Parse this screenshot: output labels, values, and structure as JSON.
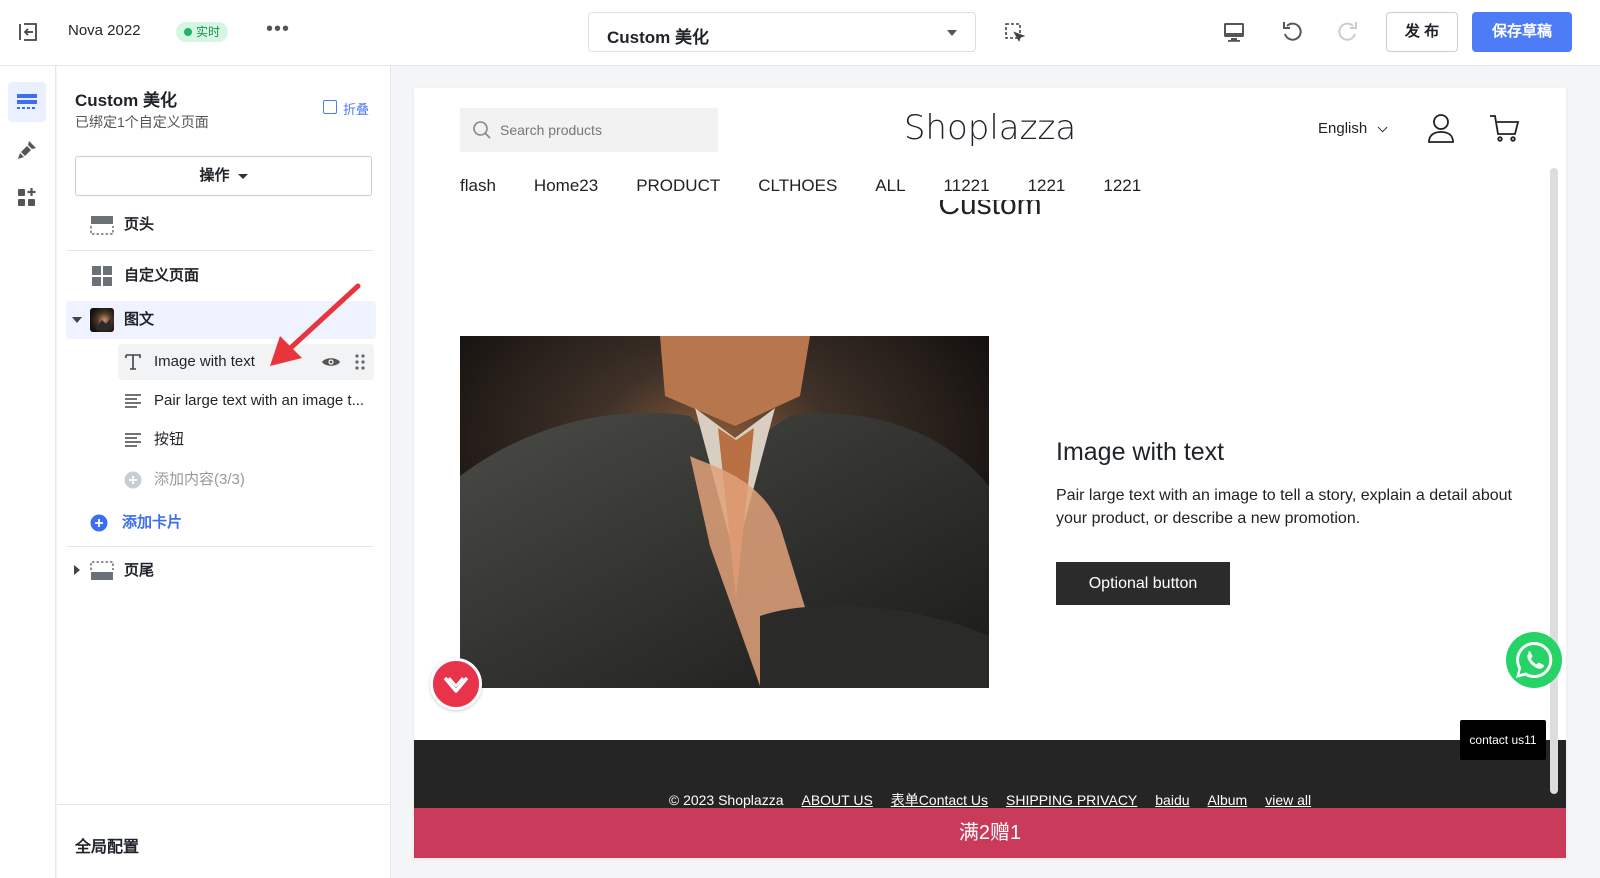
{
  "topbar": {
    "store_name": "Nova 2022",
    "live_badge": "实时",
    "more": "•••",
    "page_select": "Custom 美化",
    "publish": "发 布",
    "save_draft": "保存草稿"
  },
  "panel": {
    "title": "Custom 美化",
    "subtitle": "已绑定1个自定义页面",
    "collapse": "折叠",
    "operations": "操作",
    "header_section": "页头",
    "custom_page": "自定义页面",
    "image_text_section": "图文",
    "blocks": [
      {
        "label": "Image with text"
      },
      {
        "label": "Pair large text with an image t..."
      },
      {
        "label": "按钮"
      }
    ],
    "add_content": "添加内容(3/3)",
    "add_card": "添加卡片",
    "footer_section": "页尾",
    "global_config": "全局配置"
  },
  "preview": {
    "search_placeholder": "Search products",
    "logo": "Shoplazza",
    "language": "English",
    "nav": [
      "flash",
      "Home23",
      "PRODUCT",
      "CLTHOES",
      "ALL",
      "11221",
      "1221",
      "1221"
    ],
    "clipped_title": "Custom",
    "heading": "Image with text",
    "body": "Pair large text with an image to tell a story, explain a detail about your product, or describe a new promotion.",
    "button": "Optional button",
    "footer_copyright": "© 2023 Shoplazza",
    "footer_links": [
      "ABOUT US",
      "表单Contact Us",
      "SHIPPING PRIVACY",
      "baidu",
      "Album",
      "view all"
    ],
    "promo": "满2赠1",
    "contact": "contact us11"
  },
  "colors": {
    "accent": "#4e7cf6",
    "live_green": "#1fb36b",
    "promo_bar": "#c93a5b",
    "footer_bg": "#252525",
    "annotation_arrow": "#e8343c"
  }
}
